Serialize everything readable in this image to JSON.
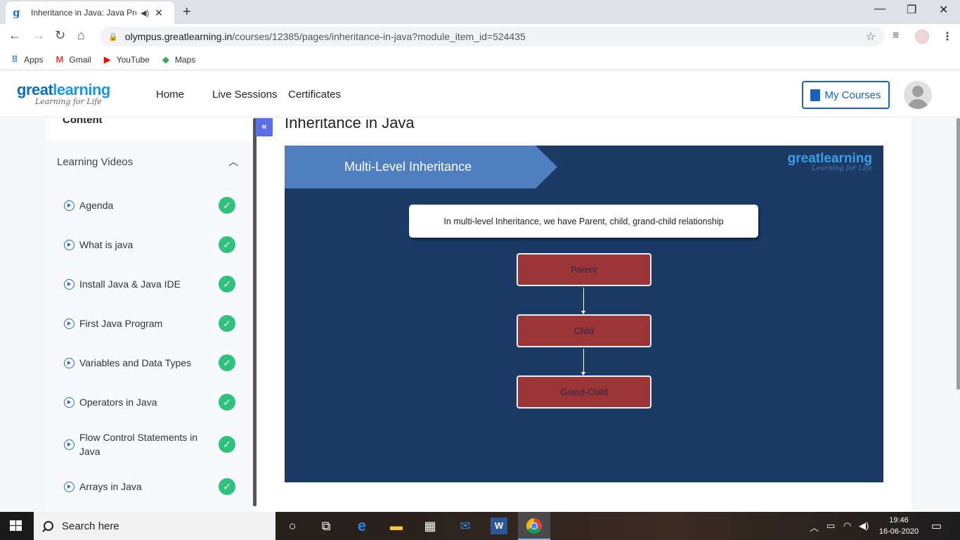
{
  "browser": {
    "tab_title": "Inheritance in Java: Java Prog",
    "tab_close": "✕",
    "new_tab": "+",
    "win_minimize": "—",
    "win_restore": "❐",
    "win_close": "✕",
    "url_domain": "olympus.greatlearning.in",
    "url_path": "/courses/12385/pages/inheritance-in-java?module_item_id=524435",
    "bookmarks": [
      {
        "label": "Apps",
        "icon": "apps-grid-icon",
        "color": "#4285f4"
      },
      {
        "label": "Gmail",
        "icon": "gmail-icon",
        "color": "#ea4335"
      },
      {
        "label": "YouTube",
        "icon": "youtube-icon",
        "color": "#ff0000"
      },
      {
        "label": "Maps",
        "icon": "maps-icon",
        "color": "#34a853"
      }
    ]
  },
  "header": {
    "logo_main_1": "great",
    "logo_main_2": "learning",
    "logo_sub": "Learning for Life",
    "nav": [
      "Home",
      "Live Sessions",
      "Certificates"
    ],
    "my_courses": "My Courses"
  },
  "sidebar": {
    "title": "Content",
    "section": "Learning Videos",
    "lessons": [
      {
        "label": "Agenda",
        "completed": true
      },
      {
        "label": "What is java",
        "completed": true
      },
      {
        "label": "Install Java & Java IDE",
        "completed": true
      },
      {
        "label": "First Java Program",
        "completed": true
      },
      {
        "label": "Variables and Data Types",
        "completed": true
      },
      {
        "label": "Operators in Java",
        "completed": true
      },
      {
        "label": "Flow Control Statements in Java",
        "completed": true
      },
      {
        "label": "Arrays in Java",
        "completed": true
      }
    ]
  },
  "main": {
    "title": "Inheritance in Java",
    "slide": {
      "banner": "Multi-Level Inheritance",
      "logo_main": "greatlearning",
      "logo_sub": "Learning for Life",
      "callout": "In multi-level Inheritance, we have Parent, child, grand-child relationship",
      "nodes": [
        "Parent",
        "Child",
        "Grand-Child"
      ]
    }
  },
  "taskbar": {
    "search_placeholder": "Search here",
    "time": "19:46",
    "date": "16-06-2020"
  },
  "colors": {
    "brand_blue": "#1565c0",
    "slide_bg": "#1b3a66",
    "banner": "#4f7fc0",
    "node": "#9c3538",
    "check": "#2ec27e",
    "collapse": "#5a6ee8"
  }
}
